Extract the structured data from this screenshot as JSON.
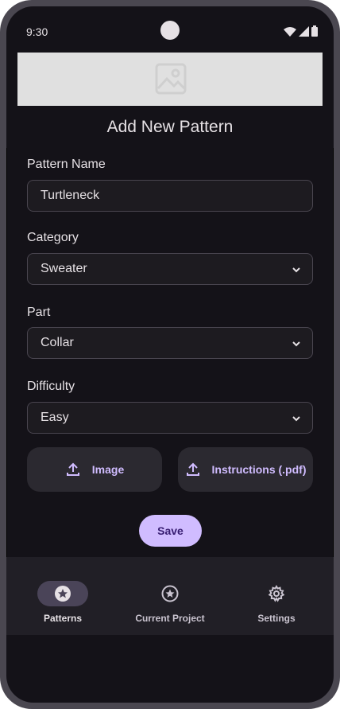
{
  "status_bar": {
    "time": "9:30"
  },
  "page_title": "Add New Pattern",
  "form": {
    "pattern_name_label": "Pattern Name",
    "pattern_name_value": "Turtleneck",
    "category_label": "Category",
    "category_value": "Sweater",
    "part_label": "Part",
    "part_value": "Collar",
    "difficulty_label": "Difficulty",
    "difficulty_value": "Easy"
  },
  "buttons": {
    "image": "Image",
    "instructions": "Instructions (.pdf)",
    "save": "Save"
  },
  "nav": {
    "items": [
      {
        "label": "Patterns",
        "icon": "star-circle-icon",
        "active": true
      },
      {
        "label": "Current Project",
        "icon": "star-circle-outline-icon",
        "active": false
      },
      {
        "label": "Settings",
        "icon": "gear-icon",
        "active": false
      }
    ]
  },
  "colors": {
    "background": "#141218",
    "accent": "#d0bcff",
    "surface": "#211f26",
    "text": "#e6e1e5"
  }
}
